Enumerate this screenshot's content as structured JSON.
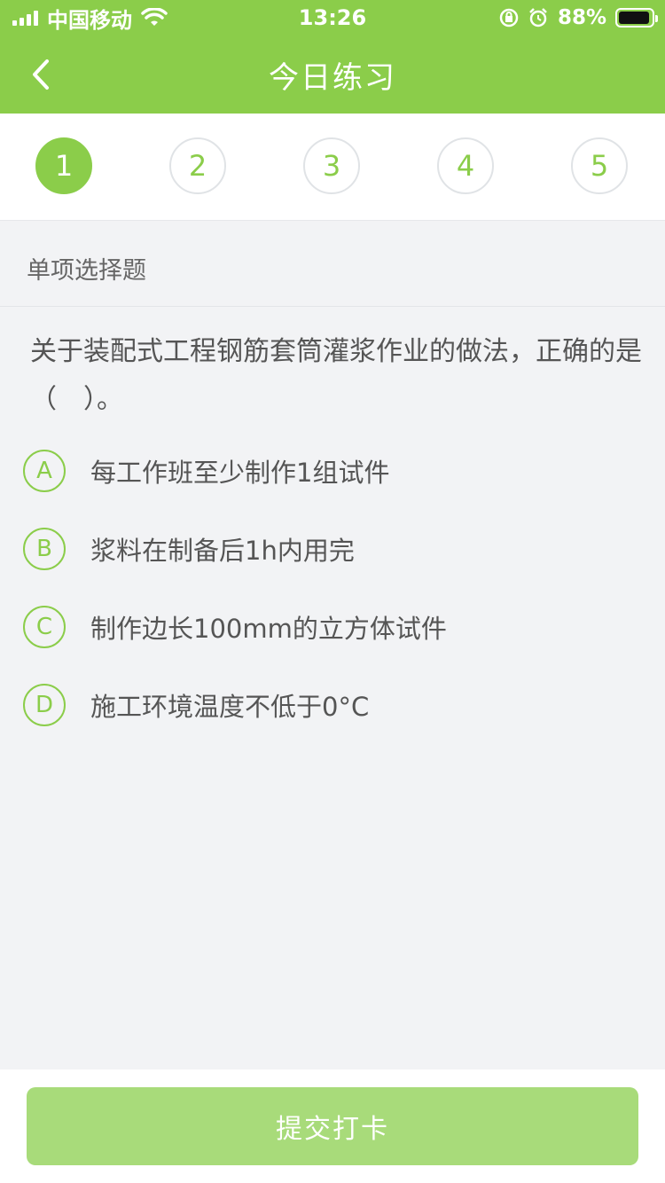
{
  "status_bar": {
    "carrier": "中国移动",
    "time": "13:26",
    "battery_percent": "88%",
    "battery_level": 0.88
  },
  "nav": {
    "title": "今日练习",
    "back_icon": "chevron-left-icon"
  },
  "steps": {
    "items": [
      "1",
      "2",
      "3",
      "4",
      "5"
    ],
    "active_index": 0
  },
  "question": {
    "type_label": "单项选择题",
    "text": "关于装配式工程钢筋套筒灌浆作业的做法，正确的是（　）。",
    "options": [
      {
        "letter": "A",
        "text": "每工作班至少制作1组试件"
      },
      {
        "letter": "B",
        "text": "浆料在制备后1h内用完"
      },
      {
        "letter": "C",
        "text": "制作边长100mm的立方体试件"
      },
      {
        "letter": "D",
        "text": "施工环境温度不低于0°C"
      }
    ]
  },
  "footer": {
    "submit_label": "提交打卡"
  },
  "colors": {
    "accent": "#8bcd4a",
    "button_disabled": "#a8db7a",
    "background": "#f2f3f5"
  }
}
